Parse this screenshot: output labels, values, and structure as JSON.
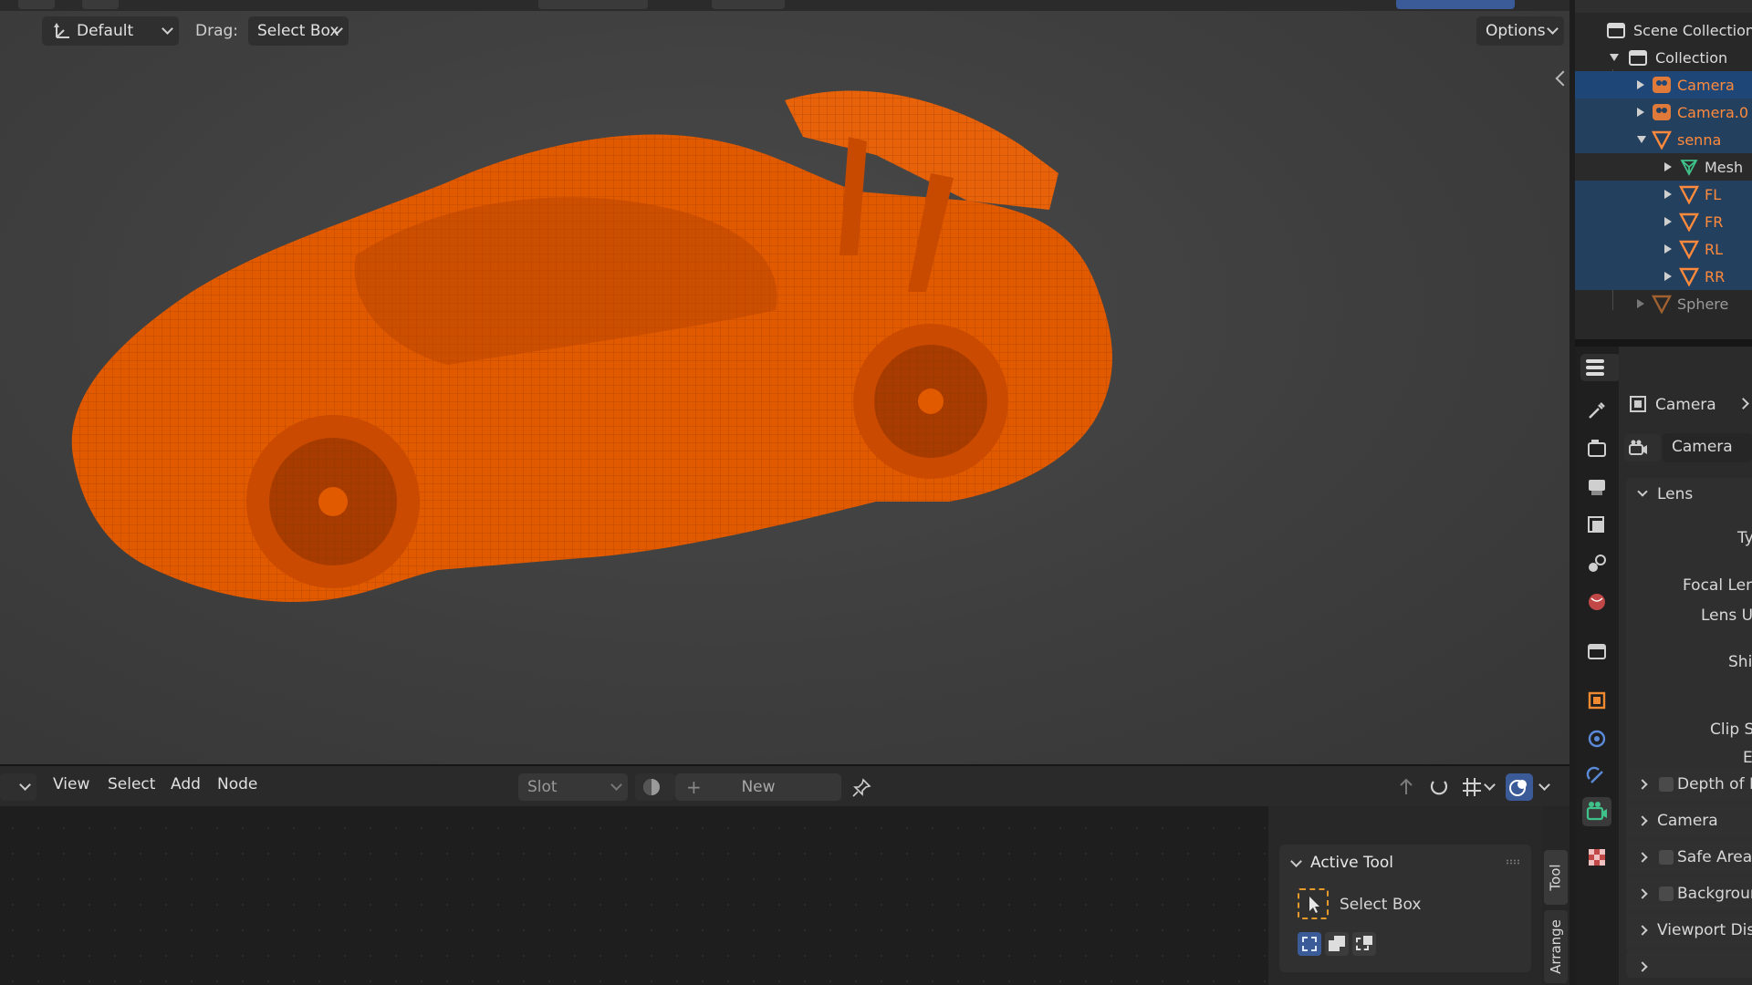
{
  "viewport": {
    "orientation_label": "Default",
    "drag_label": "Drag:",
    "drag_value": "Select Box",
    "options_label": "Options",
    "object_color": "#e15a00"
  },
  "node_editor": {
    "menu": {
      "view": "View",
      "select": "Select",
      "add": "Add",
      "node": "Node"
    },
    "slot_label": "Slot",
    "new_label": "New",
    "active_tool": {
      "title": "Active Tool",
      "tool_name": "Select Box"
    },
    "side_tabs": {
      "tool": "Tool",
      "arrange": "Arrange"
    }
  },
  "outliner": {
    "items": [
      {
        "label": "Scene Collection",
        "icon": "scene-collection-icon"
      },
      {
        "label": "Collection",
        "icon": "collection-icon"
      },
      {
        "label": "Camera",
        "icon": "camera-object-icon",
        "color": "#ff8a3c"
      },
      {
        "label": "Camera.0",
        "icon": "camera-object-icon",
        "color": "#ff8a3c"
      },
      {
        "label": "senna",
        "icon": "mesh-object-icon",
        "color": "#ff8a3c"
      },
      {
        "label": "Mesh",
        "icon": "mesh-data-icon",
        "color": "#d8d8d8"
      },
      {
        "label": "FL",
        "icon": "mesh-object-icon",
        "color": "#ff8a3c"
      },
      {
        "label": "FR",
        "icon": "mesh-object-icon",
        "color": "#ff8a3c"
      },
      {
        "label": "RL",
        "icon": "mesh-object-icon",
        "color": "#ff8a3c"
      },
      {
        "label": "RR",
        "icon": "mesh-object-icon",
        "color": "#ff8a3c"
      },
      {
        "label": "Sphere",
        "icon": "mesh-object-icon",
        "color": "#9a9a9a"
      }
    ]
  },
  "properties": {
    "breadcrumb": "Camera",
    "data_name": "Camera",
    "lens_section": "Lens",
    "fields": {
      "type": "Ty",
      "focal_length": "Focal Len",
      "lens_unit": "Lens U",
      "shift": "Shi",
      "clip_start": "Clip St",
      "clip_end": "E"
    },
    "sections": {
      "depth_of_field": "Depth of Fie",
      "camera": "Camera",
      "safe_areas": "Safe Areas",
      "background": "Background",
      "viewport_display": "Viewport Displ"
    }
  }
}
